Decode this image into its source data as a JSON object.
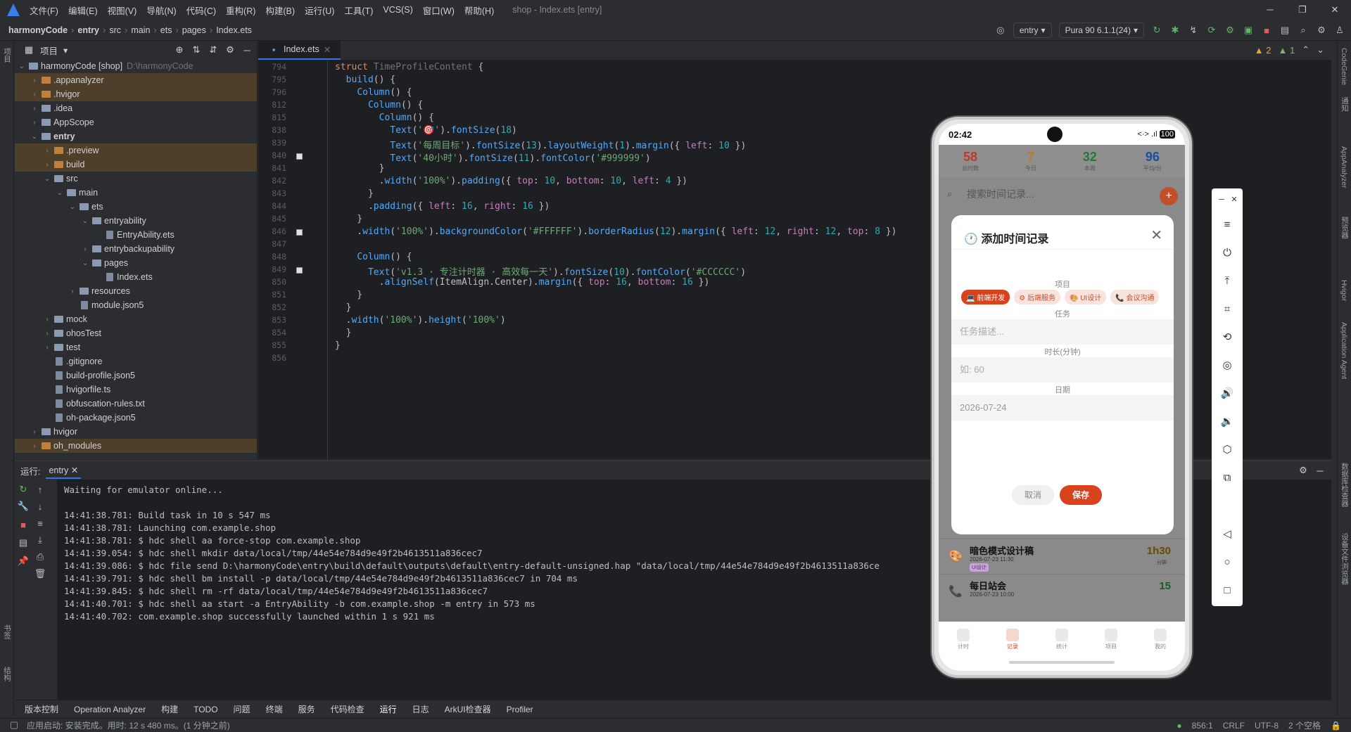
{
  "menu": {
    "items": [
      "文件(F)",
      "编辑(E)",
      "视图(V)",
      "导航(N)",
      "代码(C)",
      "重构(R)",
      "构建(B)",
      "运行(U)",
      "工具(T)",
      "VCS(S)",
      "窗口(W)",
      "帮助(H)"
    ],
    "title": "shop - Index.ets [entry]"
  },
  "breadcrumb": {
    "project": "harmonyCode",
    "module": "entry",
    "p1": "src",
    "p2": "main",
    "p3": "ets",
    "p4": "pages",
    "file": "Index.ets"
  },
  "toolbar": {
    "config": "entry",
    "device": "Pura 90 6.1.1(24)"
  },
  "editor": {
    "warnings": "2",
    "weak": "1",
    "tab": "Index.ets"
  },
  "project": {
    "header": "项目",
    "tree": [
      {
        "label": "harmonyCode [shop]",
        "dim": "D:\\harmonyCode",
        "depth": 0,
        "chev": "v",
        "kind": "folder"
      },
      {
        "label": ".appanalyzer",
        "depth": 1,
        "chev": ">",
        "kind": "folder-or",
        "hl": true
      },
      {
        "label": ".hvigor",
        "depth": 1,
        "chev": ">",
        "kind": "folder-or",
        "hl": true
      },
      {
        "label": ".idea",
        "depth": 1,
        "chev": ">",
        "kind": "folder"
      },
      {
        "label": "AppScope",
        "depth": 1,
        "chev": ">",
        "kind": "folder"
      },
      {
        "label": "entry",
        "depth": 1,
        "chev": "v",
        "kind": "folder",
        "bold": true
      },
      {
        "label": ".preview",
        "depth": 2,
        "chev": ">",
        "kind": "folder-or",
        "hl": true
      },
      {
        "label": "build",
        "depth": 2,
        "chev": ">",
        "kind": "folder-or",
        "hl": true
      },
      {
        "label": "src",
        "depth": 2,
        "chev": "v",
        "kind": "folder"
      },
      {
        "label": "main",
        "depth": 3,
        "chev": "v",
        "kind": "folder"
      },
      {
        "label": "ets",
        "depth": 4,
        "chev": "v",
        "kind": "folder"
      },
      {
        "label": "entryability",
        "depth": 5,
        "chev": "v",
        "kind": "folder"
      },
      {
        "label": "EntryAbility.ets",
        "depth": 6,
        "chev": "",
        "kind": "file"
      },
      {
        "label": "entrybackupability",
        "depth": 5,
        "chev": ">",
        "kind": "folder"
      },
      {
        "label": "pages",
        "depth": 5,
        "chev": "v",
        "kind": "folder"
      },
      {
        "label": "Index.ets",
        "depth": 6,
        "chev": "",
        "kind": "file"
      },
      {
        "label": "resources",
        "depth": 4,
        "chev": ">",
        "kind": "folder"
      },
      {
        "label": "module.json5",
        "depth": 4,
        "chev": "",
        "kind": "file"
      },
      {
        "label": "mock",
        "depth": 2,
        "chev": ">",
        "kind": "folder"
      },
      {
        "label": "ohosTest",
        "depth": 2,
        "chev": ">",
        "kind": "folder"
      },
      {
        "label": "test",
        "depth": 2,
        "chev": ">",
        "kind": "folder"
      },
      {
        "label": ".gitignore",
        "depth": 2,
        "chev": "",
        "kind": "file"
      },
      {
        "label": "build-profile.json5",
        "depth": 2,
        "chev": "",
        "kind": "file"
      },
      {
        "label": "hvigorfile.ts",
        "depth": 2,
        "chev": "",
        "kind": "file"
      },
      {
        "label": "obfuscation-rules.txt",
        "depth": 2,
        "chev": "",
        "kind": "file"
      },
      {
        "label": "oh-package.json5",
        "depth": 2,
        "chev": "",
        "kind": "file"
      },
      {
        "label": "hvigor",
        "depth": 1,
        "chev": ">",
        "kind": "folder"
      },
      {
        "label": "oh_modules",
        "depth": 1,
        "chev": ">",
        "kind": "folder-or",
        "hl": true
      }
    ]
  },
  "code": [
    {
      "n": "794",
      "t": "struct TimeProfileContent {"
    },
    {
      "n": "795",
      "t": "  build() {"
    },
    {
      "n": "796",
      "t": "    Column() {"
    },
    {
      "n": "812",
      "t": "      Column() {"
    },
    {
      "n": "815",
      "t": "        Column() {"
    },
    {
      "n": "838",
      "t": "          Text('🎯').fontSize(18)"
    },
    {
      "n": "839",
      "t": "          Text('每周目标').fontSize(13).layoutWeight(1).margin({ left: 10 })"
    },
    {
      "n": "840",
      "t": "          Text('40小时').fontSize(11).fontColor('#999999')"
    },
    {
      "n": "841",
      "t": "        }"
    },
    {
      "n": "842",
      "t": "        .width('100%').padding({ top: 10, bottom: 10, left: 4 })"
    },
    {
      "n": "843",
      "t": "      }"
    },
    {
      "n": "844",
      "t": "      .padding({ left: 16, right: 16 })"
    },
    {
      "n": "845",
      "t": "    }"
    },
    {
      "n": "846",
      "t": "    .width('100%').backgroundColor('#FFFFFF').borderRadius(12).margin({ left: 12, right: 12, top: 8 })"
    },
    {
      "n": "847",
      "t": ""
    },
    {
      "n": "848",
      "t": "    Column() {"
    },
    {
      "n": "849",
      "t": "      Text('v1.3 · 专注计时器 · 高效每一天').fontSize(10).fontColor('#CCCCCC')"
    },
    {
      "n": "850",
      "t": "        .alignSelf(ItemAlign.Center).margin({ top: 16, bottom: 16 })"
    },
    {
      "n": "851",
      "t": "    }"
    },
    {
      "n": "852",
      "t": "  }"
    },
    {
      "n": "853",
      "t": "  .width('100%').height('100%')"
    },
    {
      "n": "854",
      "t": "  }"
    },
    {
      "n": "855",
      "t": "}"
    },
    {
      "n": "856",
      "t": ""
    }
  ],
  "run": {
    "label": "运行:",
    "tab": "entry",
    "lines": [
      "Waiting for emulator online...",
      "",
      "14:41:38.781: Build task in 10 s 547 ms",
      "14:41:38.781: Launching com.example.shop",
      "14:41:38.781: $ hdc shell aa force-stop com.example.shop",
      "14:41:39.054: $ hdc shell mkdir data/local/tmp/44e54e784d9e49f2b4613511a836cec7",
      "14:41:39.086: $ hdc file send D:\\harmonyCode\\entry\\build\\default\\outputs\\default\\entry-default-unsigned.hap \"data/local/tmp/44e54e784d9e49f2b4613511a836ce",
      "14:41:39.791: $ hdc shell bm install -p data/local/tmp/44e54e784d9e49f2b4613511a836cec7 in 704 ms",
      "14:41:39.845: $ hdc shell rm -rf data/local/tmp/44e54e784d9e49f2b4613511a836cec7",
      "14:41:40.701: $ hdc shell aa start -a EntryAbility -b com.example.shop -m entry in 573 ms",
      "14:41:40.702: com.example.shop successfully launched within 1 s 921 ms"
    ]
  },
  "bottomtabs": [
    "版本控制",
    "Operation Analyzer",
    "构建",
    "TODO",
    "问题",
    "终端",
    "服务",
    "代码检查",
    "运行",
    "日志",
    "ArkUI检查器",
    "Profiler"
  ],
  "status": {
    "left": "应用启动: 安装完成。用时: 12 s 480 ms。(1 分钟之前)",
    "pos": "856:1",
    "crlf": "CRLF",
    "enc": "UTF-8",
    "indent": "2 个空格"
  },
  "leftstrip": [
    "项目",
    "书签",
    "结构"
  ],
  "rightstrip": [
    "CodeGenie",
    "通知",
    "AppAnalyzer",
    "预览器",
    "Hvigor",
    "Application Agent",
    "数据库检查器",
    "设备文件浏览器"
  ],
  "phone": {
    "time": "02:42",
    "battery": "100",
    "stats": [
      {
        "v": "58",
        "l": "总时数",
        "c": "#c0392b"
      },
      {
        "v": "7",
        "l": "今日",
        "c": "#c07a1a"
      },
      {
        "v": "32",
        "l": "本周",
        "c": "#1e7a3a"
      },
      {
        "v": "96",
        "l": "平均/分",
        "c": "#1b4f9c"
      }
    ],
    "search": "搜索时间记录...",
    "dialog": {
      "title": "添加时间记录",
      "project_label": "项目",
      "chips": [
        "💻 前端开发",
        "⚙ 后端服务",
        "🎨 UI设计",
        "📞 会议沟通"
      ],
      "task_label": "任务",
      "task_ph": "任务描述...",
      "dur_label": "时长(分钟)",
      "dur_ph": "如: 60",
      "date_label": "日期",
      "date_val": "2026-07-24",
      "cancel": "取消",
      "save": "保存"
    },
    "records": [
      {
        "t": "暗色模式设计稿",
        "d": "2026-07-23 11:30",
        "b": "UI设计",
        "r": "1h30",
        "rs": "分钟"
      },
      {
        "t": "每日站会",
        "d": "2026-07-23 10:00",
        "b": "",
        "r": "15",
        "rs": ""
      }
    ],
    "tabs": [
      "计时",
      "记录",
      "统计",
      "项目",
      "我的"
    ]
  }
}
